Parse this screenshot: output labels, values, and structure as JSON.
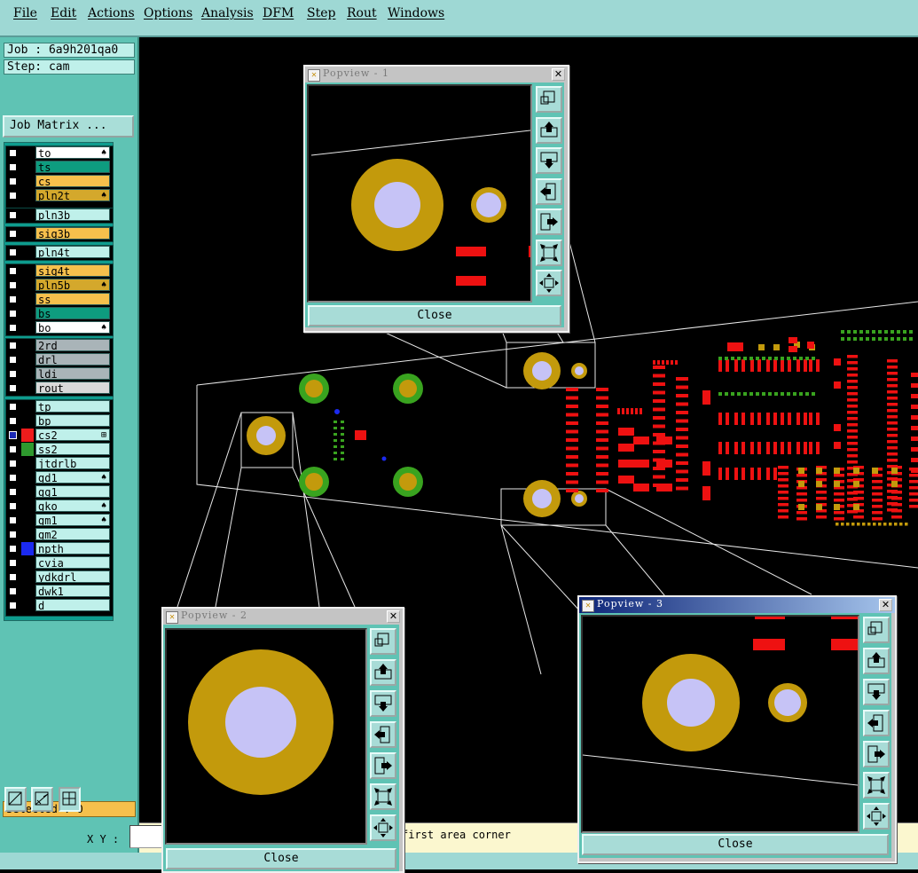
{
  "menubar": {
    "items": [
      "File",
      "Edit",
      "Actions",
      "Options",
      "Analysis",
      "DFM",
      "Step",
      "Rout",
      "Windows"
    ]
  },
  "job": {
    "label": "Job : 6a9h201qa0",
    "step": "Step: cam",
    "matrix_button": "Job Matrix ..."
  },
  "layers": [
    {
      "name": "to",
      "color": "#ffffff",
      "mark": "♠"
    },
    {
      "name": "ts",
      "color": "#0e9c7f",
      "mark": ""
    },
    {
      "name": "cs",
      "color": "#f6c04c",
      "mark": ""
    },
    {
      "name": "pln2t",
      "color": "#d4a82c",
      "mark": "♠"
    },
    {
      "name": "pln3b",
      "color": "#bff0ea",
      "mark": ""
    },
    {
      "name": "sig3b",
      "color": "#f6c04c",
      "mark": ""
    },
    {
      "name": "pln4t",
      "color": "#bff0ea",
      "mark": ""
    },
    {
      "name": "sig4t",
      "color": "#f6c04c",
      "mark": ""
    },
    {
      "name": "pln5b",
      "color": "#d4a82c",
      "mark": "♠"
    },
    {
      "name": "ss",
      "color": "#f6c04c",
      "mark": ""
    },
    {
      "name": "bs",
      "color": "#0e9c7f",
      "mark": ""
    },
    {
      "name": "bo",
      "color": "#ffffff",
      "mark": "♠"
    },
    {
      "name": "2rd",
      "color": "#a9b4b8",
      "mark": ""
    },
    {
      "name": "drl",
      "color": "#a9b4b8",
      "mark": ""
    },
    {
      "name": "ldi",
      "color": "#a9b4b8",
      "mark": ""
    },
    {
      "name": "rout",
      "color": "#d9d9d9",
      "mark": ""
    },
    {
      "name": "tp",
      "color": "#bff0ea",
      "mark": ""
    },
    {
      "name": "bp",
      "color": "#bff0ea",
      "mark": ""
    },
    {
      "name": "cs2",
      "color": "#bff0ea",
      "mark": "⊞"
    },
    {
      "name": "ss2",
      "color": "#bff0ea",
      "mark": ""
    },
    {
      "name": "jtdrlb",
      "color": "#bff0ea",
      "mark": ""
    },
    {
      "name": "gd1",
      "color": "#bff0ea",
      "mark": "♠"
    },
    {
      "name": "gg1",
      "color": "#bff0ea",
      "mark": ""
    },
    {
      "name": "gko",
      "color": "#bff0ea",
      "mark": "♠"
    },
    {
      "name": "gm1",
      "color": "#bff0ea",
      "mark": "♠"
    },
    {
      "name": "gm2",
      "color": "#bff0ea",
      "mark": ""
    },
    {
      "name": "npth",
      "color": "#bff0ea",
      "mark": ""
    },
    {
      "name": "cvia",
      "color": "#bff0ea",
      "mark": ""
    },
    {
      "name": "ydkdrl",
      "color": "#bff0ea",
      "mark": ""
    },
    {
      "name": "dwk1",
      "color": "#bff0ea",
      "mark": ""
    },
    {
      "name": "d",
      "color": "#bff0ea",
      "mark": ""
    }
  ],
  "active_layers": {
    "cs2": "#ee1c1c",
    "ss2": "#2e9a2e",
    "npth": "#1b2af0"
  },
  "selected": "Selected : 0",
  "status": {
    "xy_label": "X Y :",
    "xy_value": "",
    "message": "first area corner"
  },
  "colors": {
    "pad_gold": "#c39a0c",
    "hole": "#c6c3f6",
    "smd_red": "#ee1111",
    "via_green": "#39a31f",
    "panel_teal": "#5fc3b4"
  },
  "popviews": [
    {
      "title": "Popview - 1",
      "close": "Close"
    },
    {
      "title": "Popview - 2",
      "close": "Close"
    },
    {
      "title": "Popview - 3",
      "close": "Close"
    }
  ],
  "icons": {
    "pop_tools": [
      "zoom-fit-icon",
      "pan-up-icon",
      "pan-down-icon",
      "pan-left-icon",
      "pan-right-icon",
      "zoom-out-icon",
      "zoom-in-icon"
    ],
    "bottom_tools": [
      "select-area-icon",
      "measure-icon",
      "snap-grid-icon"
    ]
  }
}
